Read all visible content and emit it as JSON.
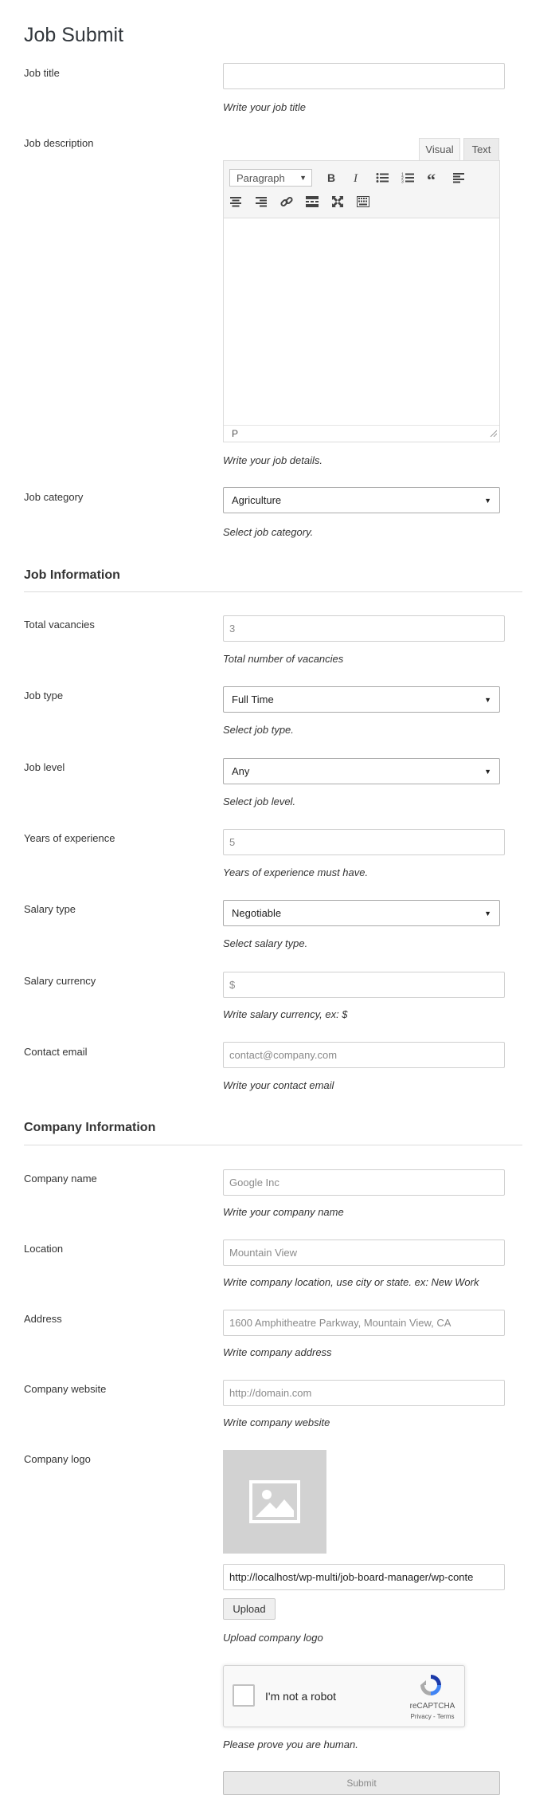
{
  "page": {
    "title": "Job Submit"
  },
  "fields": {
    "job_title": {
      "label": "Job title",
      "value": "",
      "placeholder": "",
      "desc": "Write your job title"
    },
    "job_description": {
      "label": "Job description",
      "tab_visual": "Visual",
      "tab_text": "Text",
      "format_select": "Paragraph",
      "status_path": "P",
      "desc": "Write your job details."
    },
    "job_category": {
      "label": "Job category",
      "value": "Agriculture",
      "desc": "Select job category."
    }
  },
  "job_information": {
    "title": "Job Information",
    "total_vacancies": {
      "label": "Total vacancies",
      "placeholder": "3",
      "desc": "Total number of vacancies"
    },
    "job_type": {
      "label": "Job type",
      "value": "Full Time",
      "desc": "Select job type."
    },
    "job_level": {
      "label": "Job level",
      "value": "Any",
      "desc": "Select job level."
    },
    "years_experience": {
      "label": "Years of experience",
      "placeholder": "5",
      "desc": "Years of experience must have."
    },
    "salary_type": {
      "label": "Salary type",
      "value": "Negotiable",
      "desc": "Select salary type."
    },
    "salary_currency": {
      "label": "Salary currency",
      "placeholder": "$",
      "desc": "Write salary currency, ex: $"
    },
    "contact_email": {
      "label": "Contact email",
      "placeholder": "contact@company.com",
      "desc": "Write your contact email"
    }
  },
  "company_information": {
    "title": "Company Information",
    "company_name": {
      "label": "Company name",
      "placeholder": "Google Inc",
      "desc": "Write your company name"
    },
    "location": {
      "label": "Location",
      "placeholder": "Mountain View",
      "desc": "Write company location, use city or state. ex: New Work"
    },
    "address": {
      "label": "Address",
      "placeholder": "1600 Amphitheatre Parkway, Mountain View, CA",
      "desc": "Write company address"
    },
    "website": {
      "label": "Company website",
      "placeholder": "http://domain.com",
      "desc": "Write company website"
    },
    "logo": {
      "label": "Company logo",
      "url_value": "http://localhost/wp-multi/job-board-manager/wp-conte",
      "upload_label": "Upload",
      "desc": "Upload company logo"
    }
  },
  "captcha": {
    "label": "I'm not a robot",
    "brand": "reCAPTCHA",
    "links": "Privacy - Terms",
    "desc": "Please prove you are human."
  },
  "submit": {
    "label": "Submit"
  },
  "colors": {
    "text": "#333333",
    "border": "#cfcfcf",
    "disabled_text": "#8a8a8a",
    "logo_placeholder": "#d2d2d2"
  }
}
